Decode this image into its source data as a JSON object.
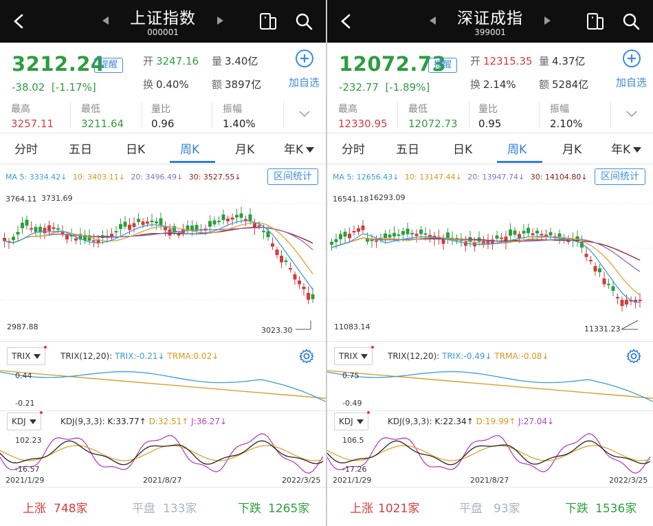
{
  "panels": [
    {
      "title": "上证指数",
      "code": "000001",
      "price": "3212.24",
      "remind": "提醒",
      "change": "-38.02",
      "change_pct": "[-1.17%]",
      "open_label": "开",
      "open": "3247.16",
      "turnover_label": "换",
      "turnover": "0.40%",
      "volume_label": "量",
      "volume": "3.40亿",
      "amount_label": "额",
      "amount": "3897亿",
      "add_label": "加自选",
      "stats": [
        {
          "label": "最高",
          "value": "3257.11"
        },
        {
          "label": "最低",
          "value": "3211.64"
        },
        {
          "label": "量比",
          "value": "0.96"
        },
        {
          "label": "振幅",
          "value": "1.40%"
        }
      ],
      "tabs": [
        "分时",
        "五日",
        "日K",
        "周K",
        "月K",
        "年K"
      ],
      "active_tab": "周K",
      "ma": {
        "ma5": "MA 5: 3334.42↓",
        "ma10": "10: 3403.11↓",
        "ma20": "20: 3496.49↓",
        "ma30": "30: 3527.55↓"
      },
      "range_btn": "区间统计",
      "y_top": "3764.11",
      "y_bottom": "2987.88",
      "max_price": "3731.69",
      "min_price": "3023.30",
      "trix": {
        "name": "TRIX",
        "params": "TRIX(12,20):",
        "trix": "TRIX:-0.21↓",
        "trma": "TRMA:0.02↓",
        "top": "0.44",
        "bottom": "-0.21"
      },
      "kdj": {
        "name": "KDJ",
        "params": "KDJ(9,3,3):",
        "k": "K:33.77↑",
        "d": "D:32.51↑",
        "j": "J:36.27↓",
        "top": "102.23",
        "bottom": "-16.57"
      },
      "dates": [
        "2021/1/29",
        "2021/8/27",
        "2022/3/25"
      ],
      "up_label": "上涨",
      "up_count": "748家",
      "flat_label": "平盘",
      "flat_count": "133家",
      "down_label": "下跌",
      "down_count": "1265家"
    },
    {
      "title": "深证成指",
      "code": "399001",
      "price": "12072.73",
      "remind": "提醒",
      "change": "-232.77",
      "change_pct": "[-1.89%]",
      "open_label": "开",
      "open": "12315.35",
      "turnover_label": "换",
      "turnover": "2.14%",
      "volume_label": "量",
      "volume": "4.37亿",
      "amount_label": "额",
      "amount": "5284亿",
      "add_label": "加自选",
      "stats": [
        {
          "label": "最高",
          "value": "12330.95"
        },
        {
          "label": "最低",
          "value": "12072.73"
        },
        {
          "label": "量比",
          "value": "0.95"
        },
        {
          "label": "振幅",
          "value": "2.10%"
        }
      ],
      "tabs": [
        "分时",
        "五日",
        "日K",
        "周K",
        "月K",
        "年K"
      ],
      "active_tab": "周K",
      "ma": {
        "ma5": "MA 5: 12656.43↓",
        "ma10": "10: 13147.44↓",
        "ma20": "20: 13947.74↓",
        "ma30": "30: 14104.80↓"
      },
      "range_btn": "区间统计",
      "y_top": "16541.18",
      "y_bottom": "11083.14",
      "max_price": "16293.09",
      "min_price": "11331.23",
      "trix": {
        "name": "TRIX",
        "params": "TRIX(12,20):",
        "trix": "TRIX:-0.49↓",
        "trma": "TRMA:-0.08↓",
        "top": "0.75",
        "bottom": "-0.49"
      },
      "kdj": {
        "name": "KDJ",
        "params": "KDJ(9,3,3):",
        "k": "K:22.34↑",
        "d": "D:19.99↑",
        "j": "J:27.04↓",
        "top": "106.5",
        "bottom": "-17.26"
      },
      "dates": [
        "2021/1/29",
        "2021/8/27",
        "2022/3/25"
      ],
      "up_label": "上涨",
      "up_count": "1021家",
      "flat_label": "平盘",
      "flat_count": "93家",
      "down_label": "下跌",
      "down_count": "1536家"
    }
  ],
  "colors": {
    "up": "#d63b3b",
    "down": "#2e9d3f",
    "accent": "#2f7ee3",
    "ma5": "#3a9ad9",
    "ma10": "#e0a12a",
    "ma20": "#8e6cc8",
    "ma30": "#8b1a1a",
    "kdj_j": "#b43fc0"
  }
}
